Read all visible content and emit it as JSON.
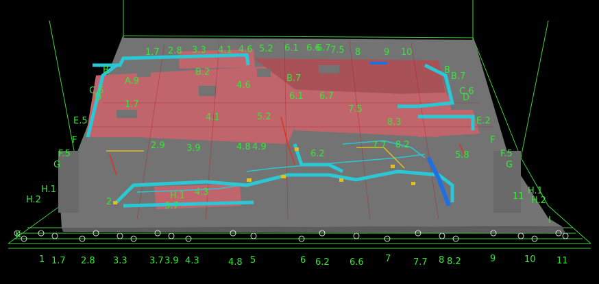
{
  "model_view": {
    "label_color": "#39e639",
    "colors": {
      "background": "#000000",
      "slab": "#737373",
      "slab_edge": "#5c5c5c",
      "zone": "#c0656c",
      "zone_dark": "#a85157",
      "duct": "#2bc7d4",
      "duct_blue": "#1e6fe0",
      "pipe_red": "#e03020",
      "pipe_yellow": "#e0c020",
      "grid": "#3fd23f"
    },
    "top_labels": [
      "1.7",
      "2.8",
      "3.3",
      "4.1",
      "4.6",
      "5.2",
      "6.1",
      "6.6",
      "6.7",
      "7.5",
      "8",
      "9",
      "10"
    ],
    "bottom_labels": [
      "1",
      "1.7",
      "2.8",
      "3.3",
      "3.7",
      "3.9",
      "4.3",
      "4.8",
      "5",
      "6",
      "6.2",
      "6.6",
      "7",
      "7.7",
      "8",
      "8.2",
      "9",
      "10",
      "11"
    ],
    "left_labels": [
      "B",
      "A.9",
      "C.6",
      "D",
      "E.5",
      "F",
      "F.5",
      "G",
      "H.1",
      "H.2",
      "K"
    ],
    "right_labels": [
      "B",
      "B.7",
      "C.6",
      "D",
      "E.2",
      "F",
      "F.5",
      "G",
      "H.1",
      "H.2",
      "I"
    ],
    "zone_labels": [
      "B.2",
      "4.6",
      "B.7",
      "6.1",
      "6.7",
      "1.7",
      "4.1",
      "5.2",
      "7.5",
      "8.3",
      "2.9",
      "3.9",
      "4.8",
      "4.9",
      "6.2",
      "7.7",
      "8.2",
      "5.8",
      "H.1",
      "4.3",
      "3.7",
      "2",
      "11"
    ]
  }
}
